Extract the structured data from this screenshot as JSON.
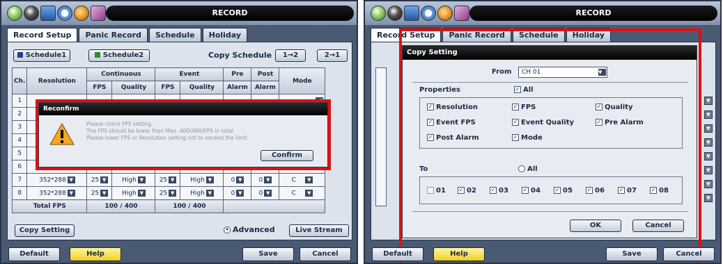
{
  "left": {
    "title": "RECORD",
    "tabs": [
      "Record Setup",
      "Panic Record",
      "Schedule",
      "Holiday"
    ],
    "schedule1": "Schedule1",
    "schedule2": "Schedule2",
    "copy_schedule_label": "Copy Schedule",
    "copy_btn_1": "1→2",
    "copy_btn_2": "2→1",
    "headers": {
      "ch": "Ch.",
      "resolution": "Resolution",
      "continuous": "Continuous",
      "event": "Event",
      "pre": "Pre",
      "alarm": "Alarm",
      "post": "Post",
      "mode": "Mode",
      "fps": "FPS",
      "quality": "Quality"
    },
    "rows": [
      {
        "ch": "1",
        "res": "",
        "fps": "",
        "q": "",
        "efps": "",
        "eq": "",
        "pre": "",
        "post": "",
        "mode": ""
      },
      {
        "ch": "2",
        "res": "",
        "fps": "",
        "q": "",
        "efps": "",
        "eq": "",
        "pre": "",
        "post": "",
        "mode": ""
      },
      {
        "ch": "3",
        "res": "",
        "fps": "",
        "q": "",
        "efps": "",
        "eq": "",
        "pre": "",
        "post": "",
        "mode": ""
      },
      {
        "ch": "4",
        "res": "",
        "fps": "",
        "q": "",
        "efps": "",
        "eq": "",
        "pre": "",
        "post": "",
        "mode": ""
      },
      {
        "ch": "5",
        "res": "",
        "fps": "",
        "q": "",
        "efps": "",
        "eq": "",
        "pre": "",
        "post": "",
        "mode": ""
      },
      {
        "ch": "6",
        "res": "",
        "fps": "",
        "q": "",
        "efps": "",
        "eq": "",
        "pre": "",
        "post": "",
        "mode": ""
      },
      {
        "ch": "7",
        "res": "352*288",
        "fps": "25",
        "q": "High",
        "efps": "25",
        "eq": "High",
        "pre": "0",
        "post": "0",
        "mode": "C"
      },
      {
        "ch": "8",
        "res": "352*288",
        "fps": "25",
        "q": "High",
        "efps": "25",
        "eq": "High",
        "pre": "0",
        "post": "0",
        "mode": "C"
      }
    ],
    "total_fps_label": "Total FPS",
    "total_cont": "100 / 400",
    "total_event": "100 / 400",
    "copy_setting": "Copy Setting",
    "advanced": "Advanced",
    "live_stream": "Live Stream",
    "default": "Default",
    "help": "Help",
    "save": "Save",
    "cancel": "Cancel",
    "dialog": {
      "title": "Reconfirm",
      "line1": "Please check FPS setting.",
      "line2": "The FPS should be lower than Max. 400(480)FPS in total.",
      "line3": "Please lower FPS or Resolution setting not to exceed the limit.",
      "confirm": "Confirm"
    }
  },
  "right": {
    "title": "RECORD",
    "tabs": [
      "Record Setup",
      "Panic Record",
      "Schedule",
      "Holiday"
    ],
    "dialog": {
      "title": "Copy Setting",
      "from_label": "From",
      "from_value": "CH 01",
      "properties_label": "Properties",
      "all_label": "All",
      "props": [
        "Resolution",
        "FPS",
        "Quality",
        "Event FPS",
        "Event Quality",
        "Pre Alarm",
        "Post Alarm",
        "Mode"
      ],
      "to_label": "To",
      "to_all": "All",
      "channels": [
        "01",
        "02",
        "03",
        "04",
        "05",
        "06",
        "07",
        "08"
      ],
      "ok": "OK",
      "cancel": "Cancel"
    },
    "default": "Default",
    "help": "Help",
    "save": "Save",
    "cancel": "Cancel"
  }
}
